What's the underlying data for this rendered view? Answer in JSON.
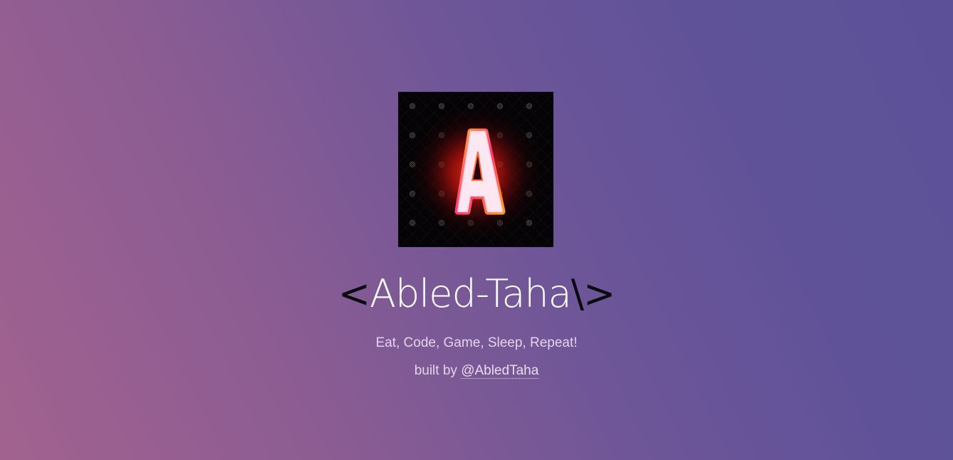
{
  "header": {
    "logo_letter": "A",
    "title_open": "<",
    "title_name": "Abled-Taha",
    "title_close": "\\>"
  },
  "content": {
    "tagline": "Eat, Code, Game, Sleep, Repeat!",
    "credit_prefix": "built by ",
    "credit_link": "@AbledTaha"
  },
  "colors": {
    "bracket": "#0a0a0f",
    "name": "#ffffff",
    "muted_text": "#e3d4ea",
    "logo_bg": "#050305",
    "logo_glow": "#ff2a1a"
  }
}
